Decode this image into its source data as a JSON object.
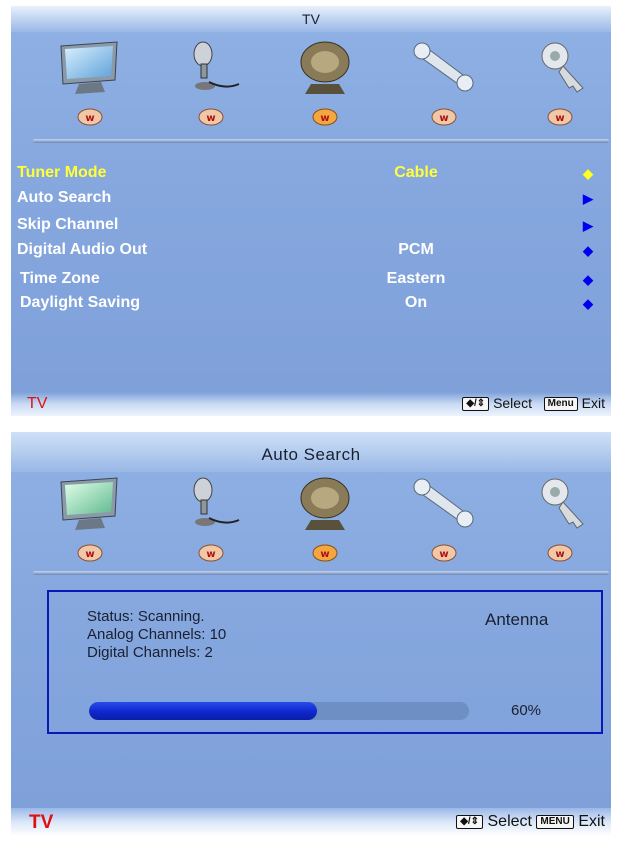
{
  "tv_menu": {
    "title": "TV",
    "rows": [
      {
        "label": "Tuner Mode",
        "value": "Cable",
        "arrow": "◆",
        "selected": true
      },
      {
        "label": "Auto Search",
        "value": "",
        "arrow": "▶",
        "selected": false
      },
      {
        "label": "Skip Channel",
        "value": "",
        "arrow": "▶",
        "selected": false
      },
      {
        "label": "Digital Audio Out",
        "value": "PCM",
        "arrow": "◆",
        "selected": false
      },
      {
        "label": "Time Zone",
        "value": "Eastern",
        "arrow": "◆",
        "selected": false
      },
      {
        "label": "Daylight Saving",
        "value": "On",
        "arrow": "◆",
        "selected": false
      }
    ],
    "bottom": {
      "source": "TV",
      "nav_key": "◆/⇕",
      "select": "Select",
      "menu_key": "Menu",
      "exit": "Exit"
    }
  },
  "auto_search": {
    "title": "Auto Search",
    "status": "Status:  Scanning.",
    "analog": "Analog  Channels:  10",
    "digital": "Digital  Channels:  2",
    "source": "Antenna",
    "progress_percent": 60,
    "progress_label": "60%",
    "bottom": {
      "source": "TV",
      "nav_key": "◆/⇕",
      "select": "Select",
      "menu_key": "MENU",
      "exit": "Exit"
    }
  },
  "icons": [
    "monitor-icon",
    "microphone-icon",
    "satellite-dish-icon",
    "wrench-icon",
    "key-icon"
  ],
  "colors": {
    "selected_text": "#ffff3a",
    "arrow": "#0000ee",
    "progress": "#1029d0",
    "box_border": "#0a18b6",
    "brand_red": "#e01010"
  }
}
